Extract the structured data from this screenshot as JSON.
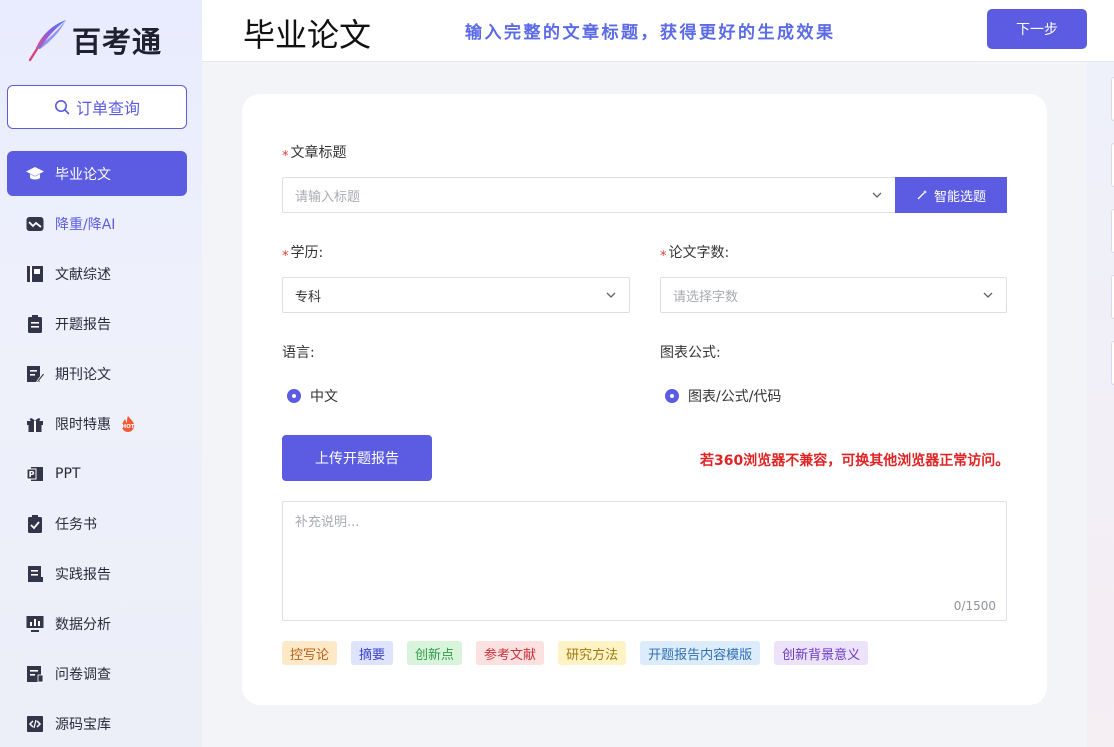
{
  "app": {
    "name": "百考通"
  },
  "sidebar": {
    "order_button": "订单查询",
    "items": [
      {
        "label": "毕业论文",
        "icon": "graduation-cap-icon",
        "active": true
      },
      {
        "label": "降重/降AI",
        "icon": "trend-down-icon"
      },
      {
        "label": "文献综述",
        "icon": "book-icon"
      },
      {
        "label": "开题报告",
        "icon": "clipboard-icon"
      },
      {
        "label": "期刊论文",
        "icon": "edit-document-icon"
      },
      {
        "label": "限时特惠",
        "icon": "gift-icon",
        "badge": "HOT"
      },
      {
        "label": "PPT",
        "icon": "ppt-icon"
      },
      {
        "label": "任务书",
        "icon": "clipboard-check-icon"
      },
      {
        "label": "实践报告",
        "icon": "report-icon"
      },
      {
        "label": "数据分析",
        "icon": "monitor-chart-icon"
      },
      {
        "label": "问卷调查",
        "icon": "survey-icon"
      },
      {
        "label": "源码宝库",
        "icon": "code-icon"
      }
    ]
  },
  "header": {
    "title": "毕业论文",
    "tip": "输入完整的文章标题，获得更好的生成效果",
    "next_button": "下一步"
  },
  "form": {
    "title_label": "文章标题",
    "title_placeholder": "请输入标题",
    "smart_button": "智能选题",
    "education_label": "学历:",
    "education_value": "专科",
    "wordcount_label": "论文字数:",
    "wordcount_placeholder": "请选择字数",
    "language_label": "语言:",
    "language_value": "中文",
    "chart_label": "图表公式:",
    "chart_value": "图表/公式/代码",
    "upload_button": "上传开题报告",
    "warning": "若360浏览器不兼容，可换其他浏览器正常访问。",
    "notes_placeholder": "补充说明...",
    "notes_count": "0/1500",
    "tags": [
      {
        "label": "控写论",
        "bg": "#fde8c8",
        "color": "#b9611a"
      },
      {
        "label": "摘要",
        "bg": "#dfe3fb",
        "color": "#3b46c8"
      },
      {
        "label": "创新点",
        "bg": "#d8f5dc",
        "color": "#2f9a46"
      },
      {
        "label": "参考文献",
        "bg": "#fde0e0",
        "color": "#c8353b"
      },
      {
        "label": "研究方法",
        "bg": "#fdf3c4",
        "color": "#a07a10"
      },
      {
        "label": "开题报告内容模版",
        "bg": "#dcecfb",
        "color": "#2f6fb5"
      },
      {
        "label": "创新背景意义",
        "bg": "#ece3fb",
        "color": "#6a3bc0"
      }
    ]
  },
  "colors": {
    "accent": "#5b5ce2",
    "warning": "#e02424"
  }
}
